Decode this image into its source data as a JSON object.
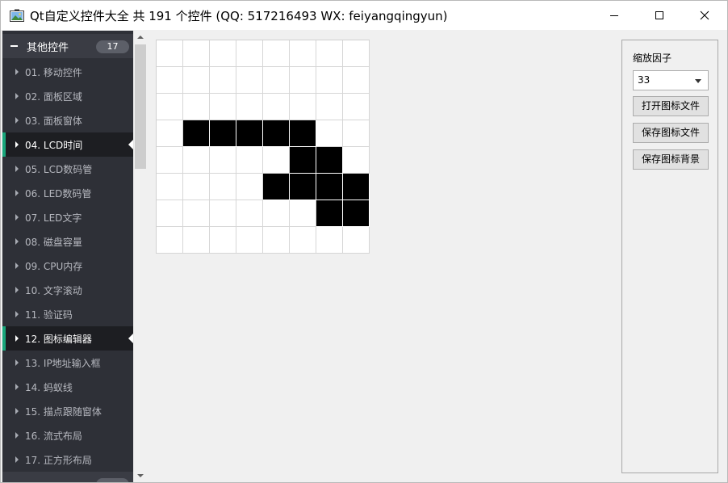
{
  "window": {
    "title": "Qt自定义控件大全 共 191 个控件 (QQ: 517216493 WX: feiyangqingyun)",
    "icons": {
      "app": "app-image-icon",
      "minimize": "minimize-icon",
      "maximize": "maximize-icon",
      "close": "close-icon"
    }
  },
  "sidebar": {
    "group_title": "其他控件",
    "group_count": "17",
    "items": [
      {
        "label": "01. 移动控件",
        "active": false
      },
      {
        "label": "02. 面板区域",
        "active": false
      },
      {
        "label": "03. 面板窗体",
        "active": false
      },
      {
        "label": "04. LCD时间",
        "active": true
      },
      {
        "label": "05. LCD数码管",
        "active": false
      },
      {
        "label": "06. LED数码管",
        "active": false
      },
      {
        "label": "07. LED文字",
        "active": false
      },
      {
        "label": "08. 磁盘容量",
        "active": false
      },
      {
        "label": "09. CPU内存",
        "active": false
      },
      {
        "label": "10. 文字滚动",
        "active": false
      },
      {
        "label": "11. 验证码",
        "active": false
      },
      {
        "label": "12. 图标编辑器",
        "active": true
      },
      {
        "label": "13. IP地址输入框",
        "active": false
      },
      {
        "label": "14. 蚂蚁线",
        "active": false
      },
      {
        "label": "15. 描点跟随窗体",
        "active": false
      },
      {
        "label": "16. 流式布局",
        "active": false
      },
      {
        "label": "17. 正方形布局",
        "active": false
      }
    ],
    "accent_color": "#18a77b"
  },
  "editor": {
    "pixels": [
      [
        0,
        0,
        0,
        0,
        0,
        0,
        0,
        0
      ],
      [
        0,
        0,
        0,
        0,
        0,
        0,
        0,
        0
      ],
      [
        0,
        0,
        0,
        0,
        0,
        0,
        0,
        0
      ],
      [
        0,
        1,
        1,
        1,
        1,
        1,
        0,
        0
      ],
      [
        0,
        0,
        0,
        0,
        0,
        1,
        1,
        0
      ],
      [
        0,
        0,
        0,
        0,
        1,
        1,
        1,
        1
      ],
      [
        0,
        0,
        0,
        0,
        0,
        0,
        1,
        1
      ],
      [
        0,
        0,
        0,
        0,
        0,
        0,
        0,
        0
      ]
    ]
  },
  "panel": {
    "scale_label": "缩放因子",
    "scale_value": "33",
    "open_button": "打开图标文件",
    "save_button": "保存图标文件",
    "save_bg_button": "保存图标背景"
  }
}
